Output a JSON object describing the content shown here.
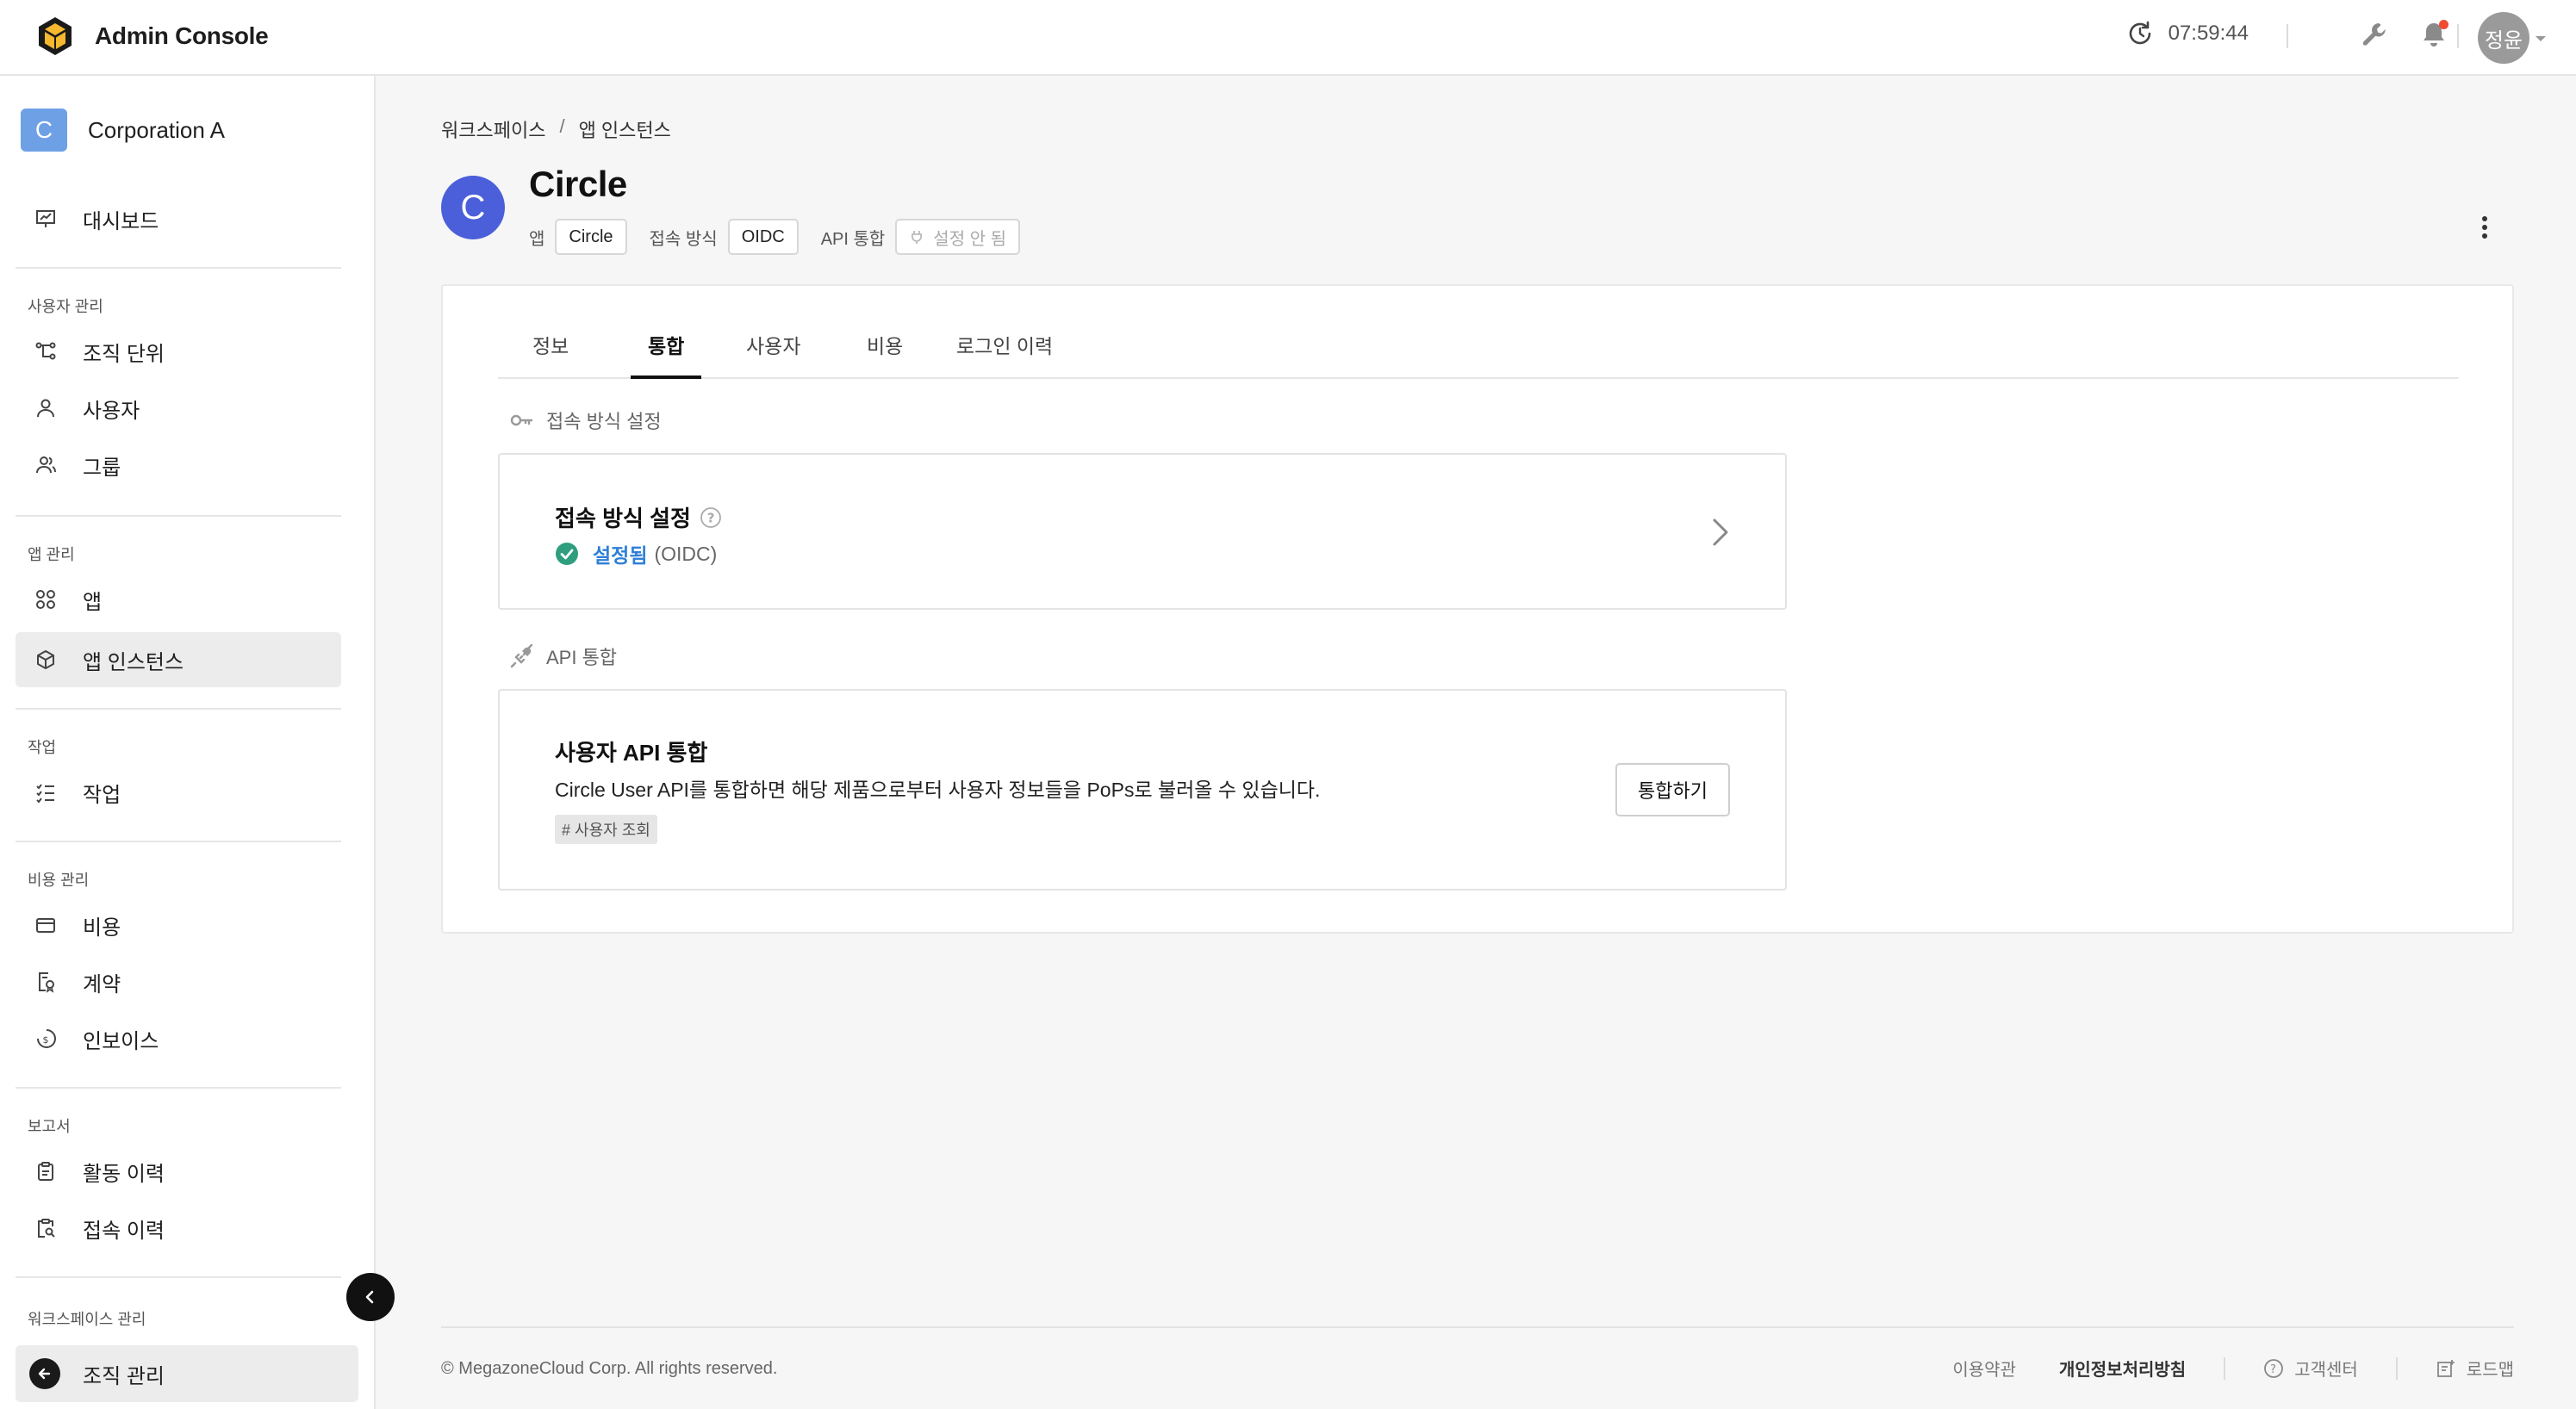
{
  "header": {
    "app_title": "Admin Console",
    "clock": "07:59:44",
    "user_initials": "정윤",
    "notification_dot_color": "#f04a32"
  },
  "sidebar": {
    "org_badge": "C",
    "org_name": "Corporation A",
    "dashboard": "대시보드",
    "user_section": "사용자 관리",
    "org_units": "조직 단위",
    "users": "사용자",
    "groups": "그룹",
    "app_section": "앱 관리",
    "apps": "앱",
    "app_instances": "앱 인스턴스",
    "task_section": "작업",
    "tasks": "작업",
    "cost_section": "비용 관리",
    "costs": "비용",
    "contracts": "계약",
    "invoices": "인보이스",
    "report_section": "보고서",
    "activity_log": "활동 이력",
    "access_log": "접속 이력",
    "workspace_section": "워크스페이스 관리",
    "org_manage": "조직 관리"
  },
  "breadcrumb": {
    "root": "워크스페이스",
    "sep": "/",
    "current": "앱 인스턴스"
  },
  "app": {
    "avatar": "C",
    "avatar_color": "#4a5fd9",
    "name": "Circle",
    "app_label": "앱",
    "app_value": "Circle",
    "access_label": "접속 방식",
    "access_value": "OIDC",
    "api_label": "API 통합",
    "api_value": "설정 안 됨"
  },
  "tabs": [
    "정보",
    "통합",
    "사용자",
    "비용",
    "로그인 이력"
  ],
  "active_tab": "통합",
  "access_section": {
    "heading": "접속 방식 설정",
    "card_title": "접속 방식 설정",
    "status": "설정됨",
    "protocol": "(OIDC)",
    "status_color": "#2f7fd8"
  },
  "api_section": {
    "heading": "API 통합",
    "card_title": "사용자 API 통합",
    "description": "Circle User API를 통합하면 해당 제품으로부터 사용자 정보들을 PoPs로 불러올 수 있습니다.",
    "tag": "# 사용자 조회",
    "button": "통합하기"
  },
  "footer": {
    "copyright": "© MegazoneCloud Corp. All rights reserved.",
    "terms": "이용약관",
    "privacy": "개인정보처리방침",
    "support": "고객센터",
    "roadmap": "로드맵"
  }
}
